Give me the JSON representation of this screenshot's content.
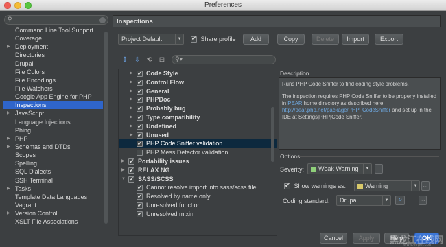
{
  "window": {
    "title": "Preferences"
  },
  "sidebar": {
    "items": [
      {
        "label": "Command Line Tool Support",
        "arrow": false
      },
      {
        "label": "Coverage",
        "arrow": false
      },
      {
        "label": "Deployment",
        "arrow": true
      },
      {
        "label": "Directories",
        "arrow": false
      },
      {
        "label": "Drupal",
        "arrow": false
      },
      {
        "label": "File Colors",
        "arrow": false
      },
      {
        "label": "File Encodings",
        "arrow": false
      },
      {
        "label": "File Watchers",
        "arrow": false
      },
      {
        "label": "Google App Engine for PHP",
        "arrow": false
      },
      {
        "label": "Inspections",
        "arrow": false,
        "selected": true
      },
      {
        "label": "JavaScript",
        "arrow": true
      },
      {
        "label": "Language Injections",
        "arrow": false
      },
      {
        "label": "Phing",
        "arrow": false
      },
      {
        "label": "PHP",
        "arrow": true
      },
      {
        "label": "Schemas and DTDs",
        "arrow": true
      },
      {
        "label": "Scopes",
        "arrow": false
      },
      {
        "label": "Spelling",
        "arrow": false
      },
      {
        "label": "SQL Dialects",
        "arrow": false
      },
      {
        "label": "SSH Terminal",
        "arrow": false
      },
      {
        "label": "Tasks",
        "arrow": true
      },
      {
        "label": "Template Data Languages",
        "arrow": false
      },
      {
        "label": "Vagrant",
        "arrow": false
      },
      {
        "label": "Version Control",
        "arrow": true
      },
      {
        "label": "XSLT File Associations",
        "arrow": false
      }
    ]
  },
  "header": {
    "title": "Inspections"
  },
  "toolbar": {
    "profile": "Project Default",
    "share_profile": "Share profile",
    "add": "Add",
    "copy": "Copy",
    "delete": "Delete",
    "import": "Import",
    "export": "Export"
  },
  "inspections": [
    {
      "label": "Code Style",
      "level": 1,
      "twisty": "▶",
      "bold": true
    },
    {
      "label": "Control Flow",
      "level": 1,
      "twisty": "▶",
      "bold": true
    },
    {
      "label": "General",
      "level": 1,
      "twisty": "▶",
      "bold": true
    },
    {
      "label": "PHPDoc",
      "level": 1,
      "twisty": "▶",
      "bold": true
    },
    {
      "label": "Probably bug",
      "level": 1,
      "twisty": "▶",
      "bold": true
    },
    {
      "label": "Type compatibility",
      "level": 1,
      "twisty": "▶",
      "bold": true
    },
    {
      "label": "Undefined",
      "level": 1,
      "twisty": "▶",
      "bold": true
    },
    {
      "label": "Unused",
      "level": 1,
      "twisty": "▶",
      "bold": true
    },
    {
      "label": "PHP Code Sniffer validation",
      "level": 1,
      "twisty": "",
      "bold": false,
      "selected": true
    },
    {
      "label": "PHP Mess Detector validation",
      "level": 1,
      "twisty": "",
      "bold": false,
      "unchecked": true
    },
    {
      "label": "Portability issues",
      "level": 0,
      "twisty": "▶",
      "bold": true
    },
    {
      "label": "RELAX NG",
      "level": 0,
      "twisty": "▶",
      "bold": true
    },
    {
      "label": "SASS/SCSS",
      "level": 0,
      "twisty": "▼",
      "bold": true
    },
    {
      "label": "Cannot resolve import into sass/scss file",
      "level": 1,
      "twisty": "",
      "bold": false
    },
    {
      "label": "Resolved by name only",
      "level": 1,
      "twisty": "",
      "bold": false
    },
    {
      "label": "Unresolved function",
      "level": 1,
      "twisty": "",
      "bold": false
    },
    {
      "label": "Unresolved mixin",
      "level": 1,
      "twisty": "",
      "bold": false
    }
  ],
  "description": {
    "label": "Description",
    "p1": "Runs PHP Code Sniffer to find coding style problems.",
    "p2_a": "The inspection requires PHP Code Sniffer to be properly installed in ",
    "p2_link1": "PEAR",
    "p2_b": " home directory as described here: ",
    "p2_link2": "http://pear.php.net/package/PHP_CodeSniffer",
    "p2_c": " and set up in the IDE at Settings|PHP|Code Sniffer."
  },
  "options": {
    "label": "Options",
    "severity_label": "Severity:",
    "severity_value": "Weak Warning",
    "severity_color": "#8fd07a",
    "show_warnings_label": "Show warnings as:",
    "warnings_value": "Warning",
    "warnings_color": "#d8c96a",
    "coding_standard_label": "Coding standard:",
    "coding_standard_value": "Drupal"
  },
  "footer": {
    "cancel": "Cancel",
    "apply": "Apply",
    "help": "Help",
    "ok": "OK"
  },
  "watermark": {
    "text": "黑龙江在线网",
    "sub": "www.evget.com"
  }
}
